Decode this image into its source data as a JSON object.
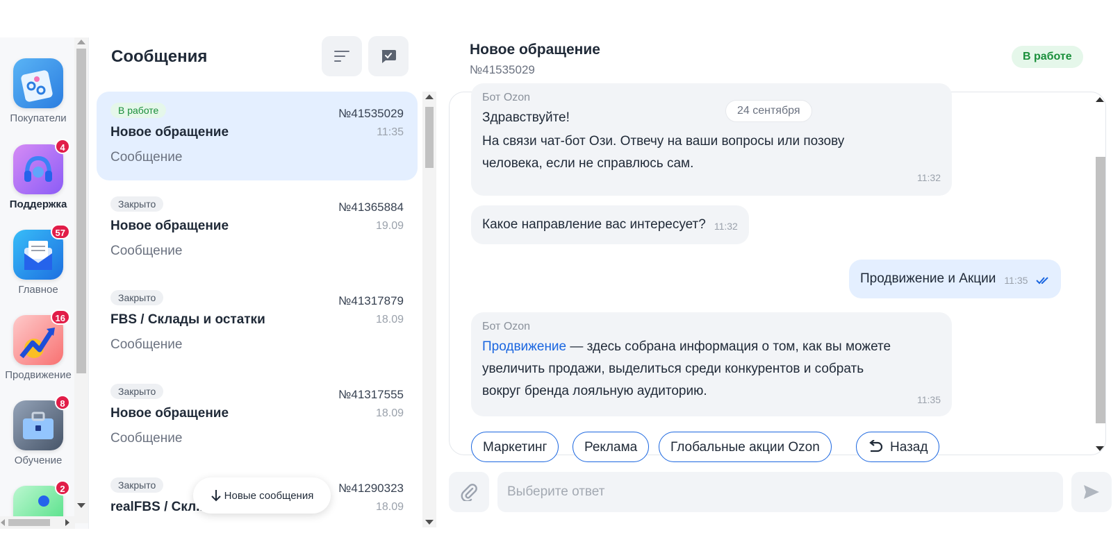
{
  "rail": {
    "apps": [
      {
        "label": "Покупатели",
        "badge": "",
        "active": false,
        "icon": "customers-icon"
      },
      {
        "label": "Поддержка",
        "badge": "4",
        "active": true,
        "icon": "headset-icon"
      },
      {
        "label": "Главное",
        "badge": "57",
        "active": false,
        "icon": "envelope-icon"
      },
      {
        "label": "Продвижение",
        "badge": "16",
        "active": false,
        "icon": "growth-arrow-icon"
      },
      {
        "label": "Обучение",
        "badge": "8",
        "active": false,
        "icon": "briefcase-icon"
      },
      {
        "label": "",
        "badge": "2",
        "active": false,
        "icon": "app-icon"
      }
    ]
  },
  "list": {
    "title": "Сообщения",
    "items": [
      {
        "status": "В работе",
        "num": "№41535029",
        "title": "Новое обращение",
        "time": "11:35",
        "sub": "Сообщение",
        "selected": true
      },
      {
        "status": "Закрыто",
        "num": "№41365884",
        "title": "Новое обращение",
        "time": "19.09",
        "sub": "Сообщение",
        "selected": false
      },
      {
        "status": "Закрыто",
        "num": "№41317879",
        "title": "FBS / Склады и остатки",
        "time": "18.09",
        "sub": "Сообщение",
        "selected": false
      },
      {
        "status": "Закрыто",
        "num": "№41317555",
        "title": "Новое обращение",
        "time": "18.09",
        "sub": "Сообщение",
        "selected": false
      },
      {
        "status": "Закрыто",
        "num": "№41290323",
        "title": "realFBS / Скл...",
        "time": "18.09",
        "sub": "",
        "selected": false
      }
    ],
    "new_messages_label": "Новые сообщения"
  },
  "chat": {
    "title": "Новое обращение",
    "num": "№41535029",
    "status": "В работе",
    "date": "24 сентября",
    "messages": [
      {
        "sender": "Бот Ozon",
        "p1": "Здравствуйте!",
        "p2": "На связи чат-бот Ози. Отвечу на ваши вопросы или позову",
        "p3": "человека, если не справлюсь сам.",
        "time": "11:32"
      },
      {
        "text": "Какое направление вас интересует?",
        "time": "11:32"
      },
      {
        "text": "Продвижение и Акции",
        "time": "11:35"
      },
      {
        "sender": "Бот Ozon",
        "link": "Продвижение",
        "l1": " — здесь собрана информация о том, как вы можете",
        "l2": "увеличить продажи, выделиться среди конкурентов и собрать",
        "l3": "вокруг бренда лояльную аудиторию.",
        "time": "11:35"
      }
    ],
    "quick_replies": [
      "Маркетинг",
      "Реклама",
      "Глобальные акции Ozon",
      "Назад"
    ],
    "input_placeholder": "Выберите ответ"
  },
  "colors": {
    "accent": "#1a66e0",
    "selected_bg": "#e4efff",
    "status_green": "#1a8f3b",
    "badge_red": "#e11d48"
  }
}
